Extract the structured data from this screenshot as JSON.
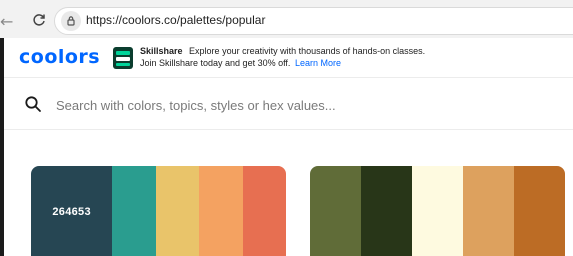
{
  "browser": {
    "url": "https://coolors.co/palettes/popular"
  },
  "header": {
    "logo": "coolors",
    "ad": {
      "brand": "Skillshare",
      "text": "Explore your creativity with thousands of hands-on classes. Join Skillshare today and get 30% off.",
      "link": "Learn More"
    }
  },
  "search": {
    "placeholder": "Search with colors, topics, styles or hex values..."
  },
  "palettes": [
    {
      "colors": [
        "#264653",
        "#2a9d8f",
        "#e9c46a",
        "#f4a261",
        "#e76f51"
      ],
      "hovered_label": "264653"
    },
    {
      "colors": [
        "#606c38",
        "#283618",
        "#fefae0",
        "#dda15e",
        "#bc6c25"
      ]
    }
  ],
  "icons": {
    "back": "arrow-left-icon",
    "reload": "reload-icon",
    "site_info": "tune-icon",
    "ad": "skillshare-logo-icon",
    "search": "search-icon"
  }
}
